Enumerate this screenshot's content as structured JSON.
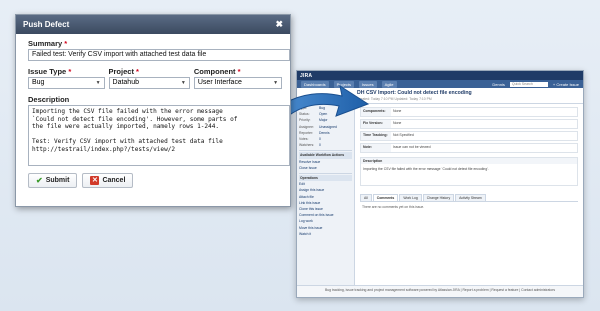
{
  "dialog": {
    "title": "Push Defect",
    "close_glyph": "✖",
    "summary_label": "Summary",
    "summary_value": "Failed test: Verify CSV import with attached test data file",
    "issue_type_label": "Issue Type",
    "issue_type_value": "Bug",
    "project_label": "Project",
    "project_value": "Datahub",
    "component_label": "Component",
    "component_value": "User Interface",
    "description_label": "Description",
    "description_value": "Importing the CSV file failed with the error message\n`Could not detect file encoding'. However, some parts of\nthe file were actually imported, namely rows 1-244.\n\nTest: Verify CSV import with attached test data file\nhttp://testrail/index.php?/tests/view/2",
    "required_mark": "*",
    "submit_label": "Submit",
    "cancel_label": "Cancel"
  },
  "jira": {
    "logo": "JIRA",
    "user": "Dennis",
    "nav": [
      "Dashboards",
      "Projects",
      "Issues",
      "Agile"
    ],
    "search_placeholder": "Quick Search",
    "create_issue": "+ Create Issue",
    "issue_key": "DH",
    "issue_title": "CSV Import: Could not detect file encoding",
    "issue_meta": "Created: Today 7:10 PM   Updated: Today 7:10 PM",
    "left_fields": [
      {
        "k": "Type:",
        "v": "Bug"
      },
      {
        "k": "Status:",
        "v": "Open"
      },
      {
        "k": "Priority:",
        "v": "Major"
      },
      {
        "k": "Assignee:",
        "v": "Unassigned"
      },
      {
        "k": "Reporter:",
        "v": "Dennis"
      },
      {
        "k": "Votes:",
        "v": "0"
      },
      {
        "k": "Watchers:",
        "v": "0"
      }
    ],
    "workflow_header": "Available Workflow Actions",
    "workflow_actions": [
      "Resolve Issue",
      "Close Issue"
    ],
    "operations_header": "Operations",
    "operations": [
      "Edit",
      "Assign this issue",
      "Attach file",
      "Link this issue",
      "Clone this issue",
      "Comment on this issue",
      "Log work",
      "Move this issue",
      "Watch it"
    ],
    "rows": [
      {
        "lab": "Components:",
        "val": "None"
      },
      {
        "lab": "Fix Version:",
        "val": "None"
      },
      {
        "lab": "Time Tracking:",
        "val": "Not Specified"
      },
      {
        "lab": "Note:",
        "val": "Issue can not be viewed"
      }
    ],
    "description_header": "Description",
    "description_text": "Importing the CSV file failed with the error message `Could not detect file encoding'.",
    "tabs": [
      "All",
      "Comments",
      "Work Log",
      "Change History",
      "Activity Stream"
    ],
    "active_tab": "Comments",
    "no_comments": "There are no comments yet on this issue.",
    "footer": "Bug tracking, issue tracking and project management software powered by Atlassian JIRA | Report a problem | Request a feature | Contact administrators"
  },
  "colors": {
    "dialog_title_bg": "#3b4a60",
    "required": "#d0021b",
    "submit_icon": "#3a9a2a",
    "cancel_icon": "#d13a2a",
    "arrow": "#2f6fb5",
    "jira_top": "#1f3b67"
  }
}
